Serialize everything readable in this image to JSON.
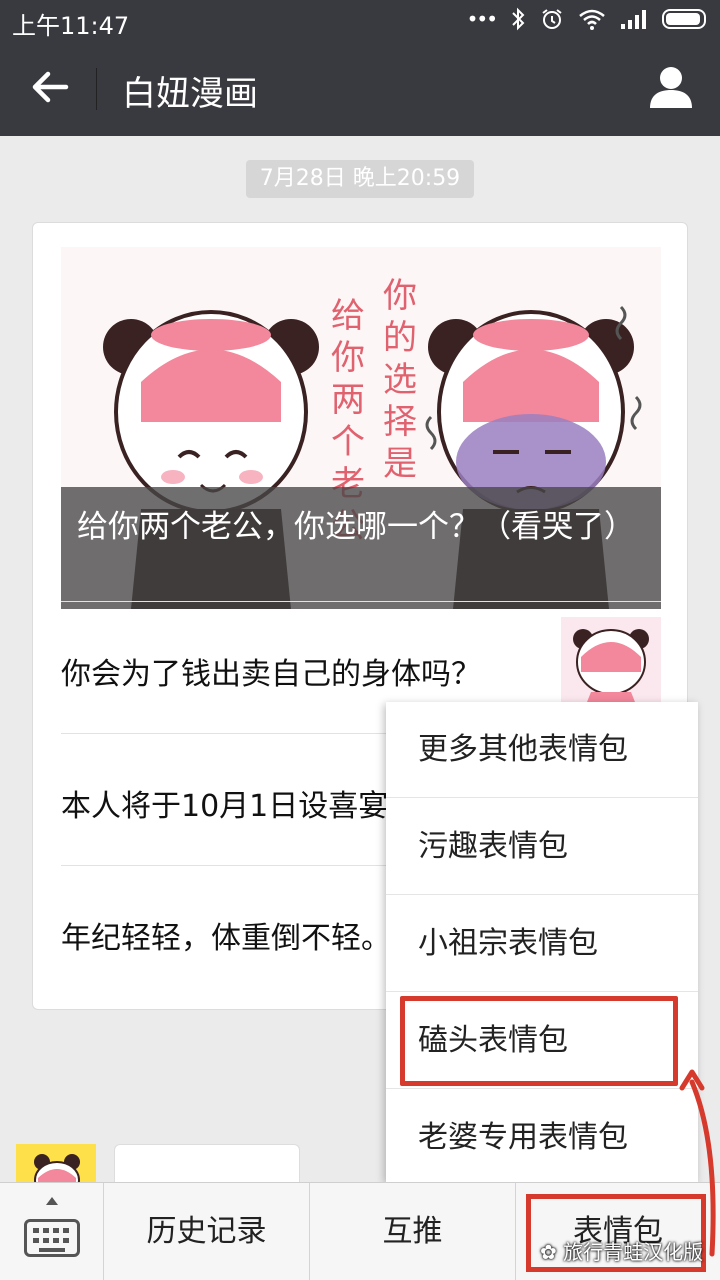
{
  "status_bar": {
    "time": "上午11:47"
  },
  "header": {
    "title": "白妞漫画"
  },
  "conversation": {
    "date_stamp": "7月28日 晚上20:59",
    "article": {
      "cover_caption": "给你两个老公，你选哪一个？（看哭了）",
      "items": [
        {
          "title": "你会为了钱出卖自己的身体吗？"
        },
        {
          "title": "本人将于10月1日设喜宴"
        },
        {
          "title": "年纪轻轻，体重倒不轻。"
        }
      ]
    }
  },
  "popup_menu": {
    "items": [
      {
        "label": "更多其他表情包"
      },
      {
        "label": "污趣表情包"
      },
      {
        "label": "小祖宗表情包"
      },
      {
        "label": "磕头表情包",
        "highlighted": true
      },
      {
        "label": "老婆专用表情包"
      }
    ]
  },
  "bottom_menu": {
    "tabs": [
      {
        "label": "历史记录"
      },
      {
        "label": "互推"
      },
      {
        "label": "表情包",
        "highlighted": true
      }
    ]
  },
  "watermark": "旅行青蛙汉化版",
  "colors": {
    "bar": "#393a3f",
    "background": "#ebebeb",
    "highlight": "#d63a2c"
  }
}
